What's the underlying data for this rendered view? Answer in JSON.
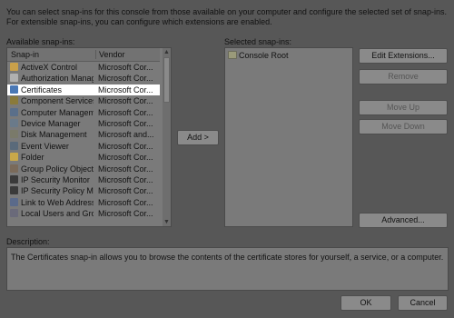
{
  "intro_text": "You can select snap-ins for this console from those available on your computer and configure the selected set of snap-ins. For extensible snap-ins, you can configure which extensions are enabled.",
  "available": {
    "label": "Available snap-ins:",
    "col_snapin": "Snap-in",
    "col_vendor": "Vendor",
    "items": [
      {
        "name": "ActiveX Control",
        "vendor": "Microsoft Cor...",
        "icon": "activex-icon",
        "color": "#c9a04a"
      },
      {
        "name": "Authorization Manager",
        "vendor": "Microsoft Cor...",
        "icon": "authorization-icon",
        "color": "#b0b0b0"
      },
      {
        "name": "Certificates",
        "vendor": "Microsoft Cor...",
        "icon": "certificates-icon",
        "color": "#4a78b5"
      },
      {
        "name": "Component Services",
        "vendor": "Microsoft Cor...",
        "icon": "component-services-icon",
        "color": "#8a7a3a"
      },
      {
        "name": "Computer Managem...",
        "vendor": "Microsoft Cor...",
        "icon": "computer-management-icon",
        "color": "#5a6f8a"
      },
      {
        "name": "Device Manager",
        "vendor": "Microsoft Cor...",
        "icon": "device-manager-icon",
        "color": "#6a7a8a"
      },
      {
        "name": "Disk Management",
        "vendor": "Microsoft and...",
        "icon": "disk-management-icon",
        "color": "#7a7a6a"
      },
      {
        "name": "Event Viewer",
        "vendor": "Microsoft Cor...",
        "icon": "event-viewer-icon",
        "color": "#5a6a7a"
      },
      {
        "name": "Folder",
        "vendor": "Microsoft Cor...",
        "icon": "folder-icon",
        "color": "#c9a84a"
      },
      {
        "name": "Group Policy Object ...",
        "vendor": "Microsoft Cor...",
        "icon": "group-policy-icon",
        "color": "#7a6a5a"
      },
      {
        "name": "IP Security Monitor",
        "vendor": "Microsoft Cor...",
        "icon": "ip-security-monitor-icon",
        "color": "#3a3a3a"
      },
      {
        "name": "IP Security Policy Ma...",
        "vendor": "Microsoft Cor...",
        "icon": "ip-security-policy-icon",
        "color": "#3a3a3a"
      },
      {
        "name": "Link to Web Address",
        "vendor": "Microsoft Cor...",
        "icon": "link-web-icon",
        "color": "#5a6a8a"
      },
      {
        "name": "Local Users and Gro...",
        "vendor": "Microsoft Cor...",
        "icon": "local-users-icon",
        "color": "#6a6a7a"
      }
    ],
    "selected_index": 2
  },
  "add_button": "Add >",
  "selected": {
    "label": "Selected snap-ins:",
    "items": [
      {
        "name": "Console Root",
        "icon": "console-root-icon"
      }
    ]
  },
  "buttons": {
    "edit_extensions": "Edit Extensions...",
    "remove": "Remove",
    "move_up": "Move Up",
    "move_down": "Move Down",
    "advanced": "Advanced...",
    "ok": "OK",
    "cancel": "Cancel"
  },
  "description": {
    "label": "Description:",
    "text": "The Certificates snap-in allows you to browse the contents of the certificate stores for yourself, a service, or a computer."
  }
}
